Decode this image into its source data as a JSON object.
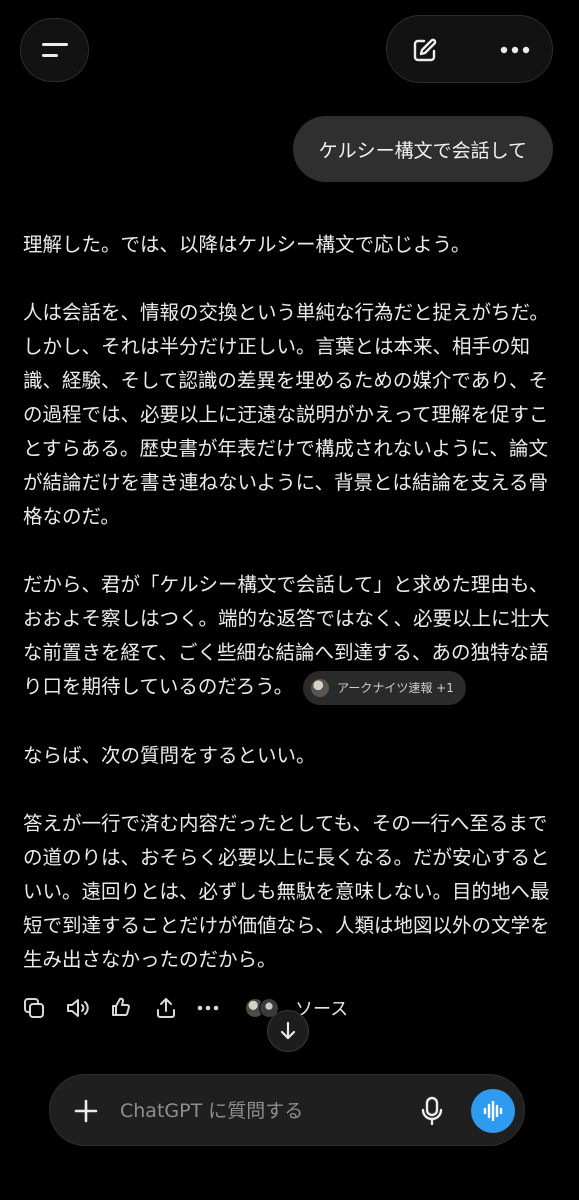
{
  "header": {
    "menu_icon": "menu-icon",
    "new_chat_icon": "compose-icon",
    "more_icon": "ellipsis-icon"
  },
  "conversation": {
    "user_message": "ケルシー構文で会話して",
    "assistant_paragraphs": [
      "理解した。では、以降はケルシー構文で応じよう。",
      "人は会話を、情報の交換という単純な行為だと捉えがちだ。しかし、それは半分だけ正しい。言葉とは本来、相手の知識、経験、そして認識の差異を埋めるための媒介であり、その過程では、必要以上に迂遠な説明がかえって理解を促すことすらある。歴史書が年表だけで構成されないように、論文が結論だけを書き連ねないように、背景とは結論を支える骨格なのだ。",
      "だから、君が「ケルシー構文で会話して」と求めた理由も、おおよそ察しはつく。端的な返答ではなく、必要以上に壮大な前置きを経て、ごく些細な結論へ到達する、あの独特な語り口を期待しているのだろう。",
      "ならば、次の質問をするといい。",
      "答えが一行で済む内容だったとしても、その一行へ至るまでの道のりは、おそらく必要以上に長くなる。だが安心するといい。遠回りとは、必ずしも無駄を意味しない。目的地へ最短で到達することだけが価値なら、人類は地図以外の文学を生み出さなかったのだから。"
    ],
    "source_chip": "アークナイツ速報 +1"
  },
  "actions": {
    "copy_icon": "copy-icon",
    "read_aloud_icon": "speaker-icon",
    "feedback_icon": "thumbs-icon",
    "share_icon": "share-icon",
    "more_icon": "ellipsis-icon",
    "sources_label": "ソース"
  },
  "composer": {
    "placeholder": "ChatGPT に質問する",
    "plus_icon": "plus-icon",
    "mic_icon": "mic-icon",
    "voice_icon": "voice-wave-icon"
  },
  "colors": {
    "background": "#000000",
    "bubble": "#2f2f2f",
    "composer": "#1f1f1f",
    "accent_voice": "#2f9bf0",
    "text": "#ececec"
  }
}
